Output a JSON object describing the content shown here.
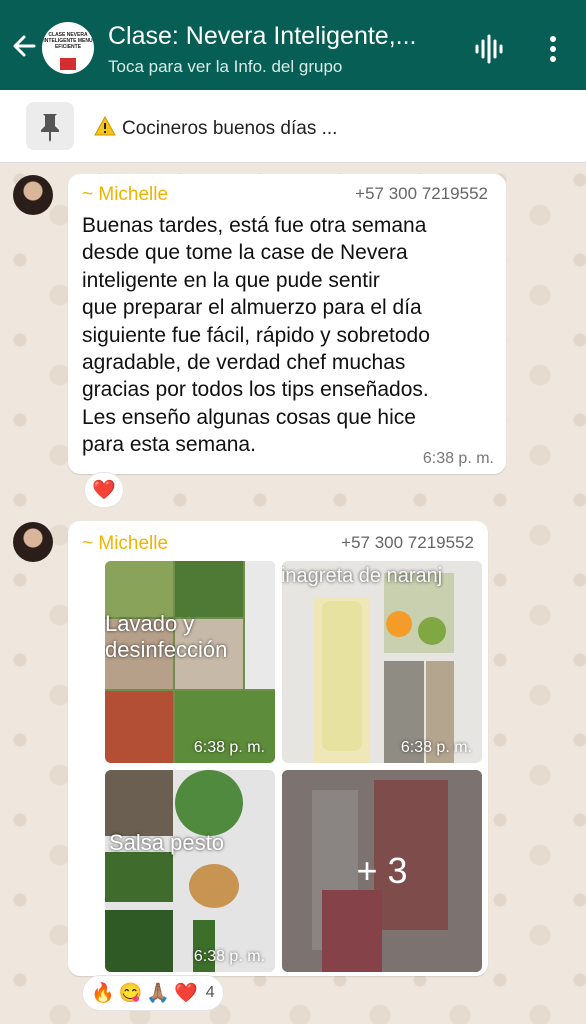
{
  "header": {
    "title": "Clase: Nevera Inteligente,...",
    "subtitle": "Toca para ver la Info. del grupo",
    "avatar_text": "CLASE NEVERA INTELIGENTE MENU EFICIENTE"
  },
  "pinned": {
    "text": "Cocineros buenos días ..."
  },
  "messages": [
    {
      "sender": "~ Michelle",
      "phone": "+57 300 7219552",
      "text": "Buenas tardes,  está fue otra semana\ndesde que tome la case de Nevera\ninteligente  en la que pude sentir\nque preparar el almuerzo para el día\nsiguiente fue fácil, rápido y sobretodo\nagradable, de verdad  chef muchas\ngracias por todos los tips enseñados.\nLes enseño algunas cosas que hice\npara esta semana.",
      "time": "6:38 p. m.",
      "reaction": "❤️"
    },
    {
      "sender": "~ Michelle",
      "phone": "+57 300 7219552",
      "images": [
        {
          "caption": "Lavado y\ndesinfección",
          "time": "6:38 p. m."
        },
        {
          "caption": "Vinagreta de naranj",
          "time": "6:38 p. m."
        },
        {
          "caption": "Salsa pesto",
          "time": "6:38 p. m."
        },
        {
          "caption": "",
          "more": "+ 3"
        }
      ],
      "reactions": [
        "🔥",
        "😋",
        "🙏🏽",
        "❤️"
      ],
      "reaction_count": "4"
    }
  ],
  "colors": {
    "header": "#075e54",
    "sender": "#f0b300",
    "chat_bg": "#efe7de"
  }
}
